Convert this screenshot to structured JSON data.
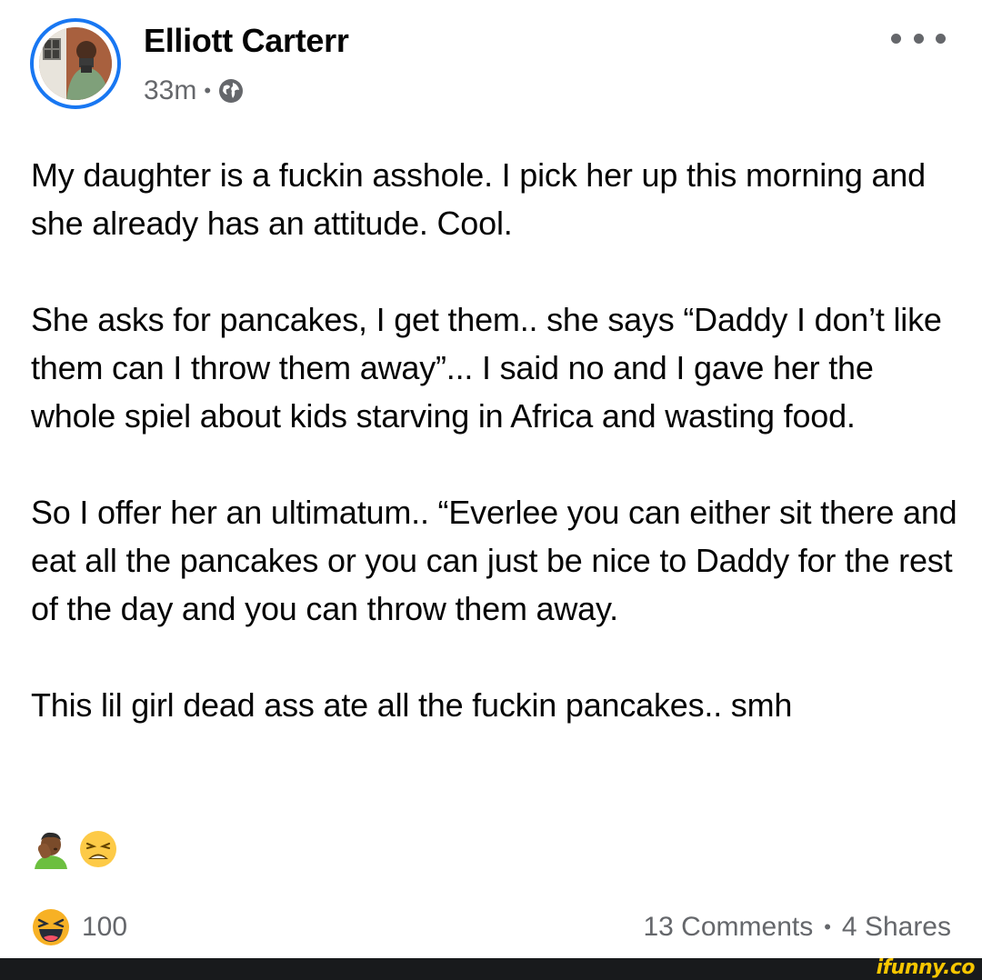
{
  "post": {
    "author": {
      "name": "Elliott Carterr",
      "timestamp": "33m",
      "separator": "•",
      "audience_icon": "globe-icon"
    },
    "body_paragraphs": [
      "My daughter is a fuckin asshole. I pick her up this morning and she already has an attitude. Cool.",
      "She asks for pancakes, I get them.. she says “Daddy I don’t like them can I throw them away”... I said no and I gave her the whole spiel about kids starving in Africa and wasting food.",
      "So I offer her an ultimatum.. “Everlee you can either sit there and eat all the pancakes or you can just be nice to Daddy for the rest of the day and you can throw them away.",
      "This lil girl dead ass ate all the fuckin pancakes.. smh"
    ],
    "emojis": [
      "man-facepalming-emoji",
      "weary-face-emoji"
    ],
    "reactions": {
      "icon": "haha-reaction-icon",
      "count": "100"
    },
    "engagement": {
      "comments": "13 Comments",
      "separator": "•",
      "shares": "4 Shares"
    }
  },
  "watermark": {
    "text": "ifunny.co"
  },
  "colors": {
    "accent": "#1877f2",
    "text_primary": "#050505",
    "text_secondary": "#65676b",
    "watermark_bar": "#181a1c",
    "watermark_text": "#f7c600"
  }
}
